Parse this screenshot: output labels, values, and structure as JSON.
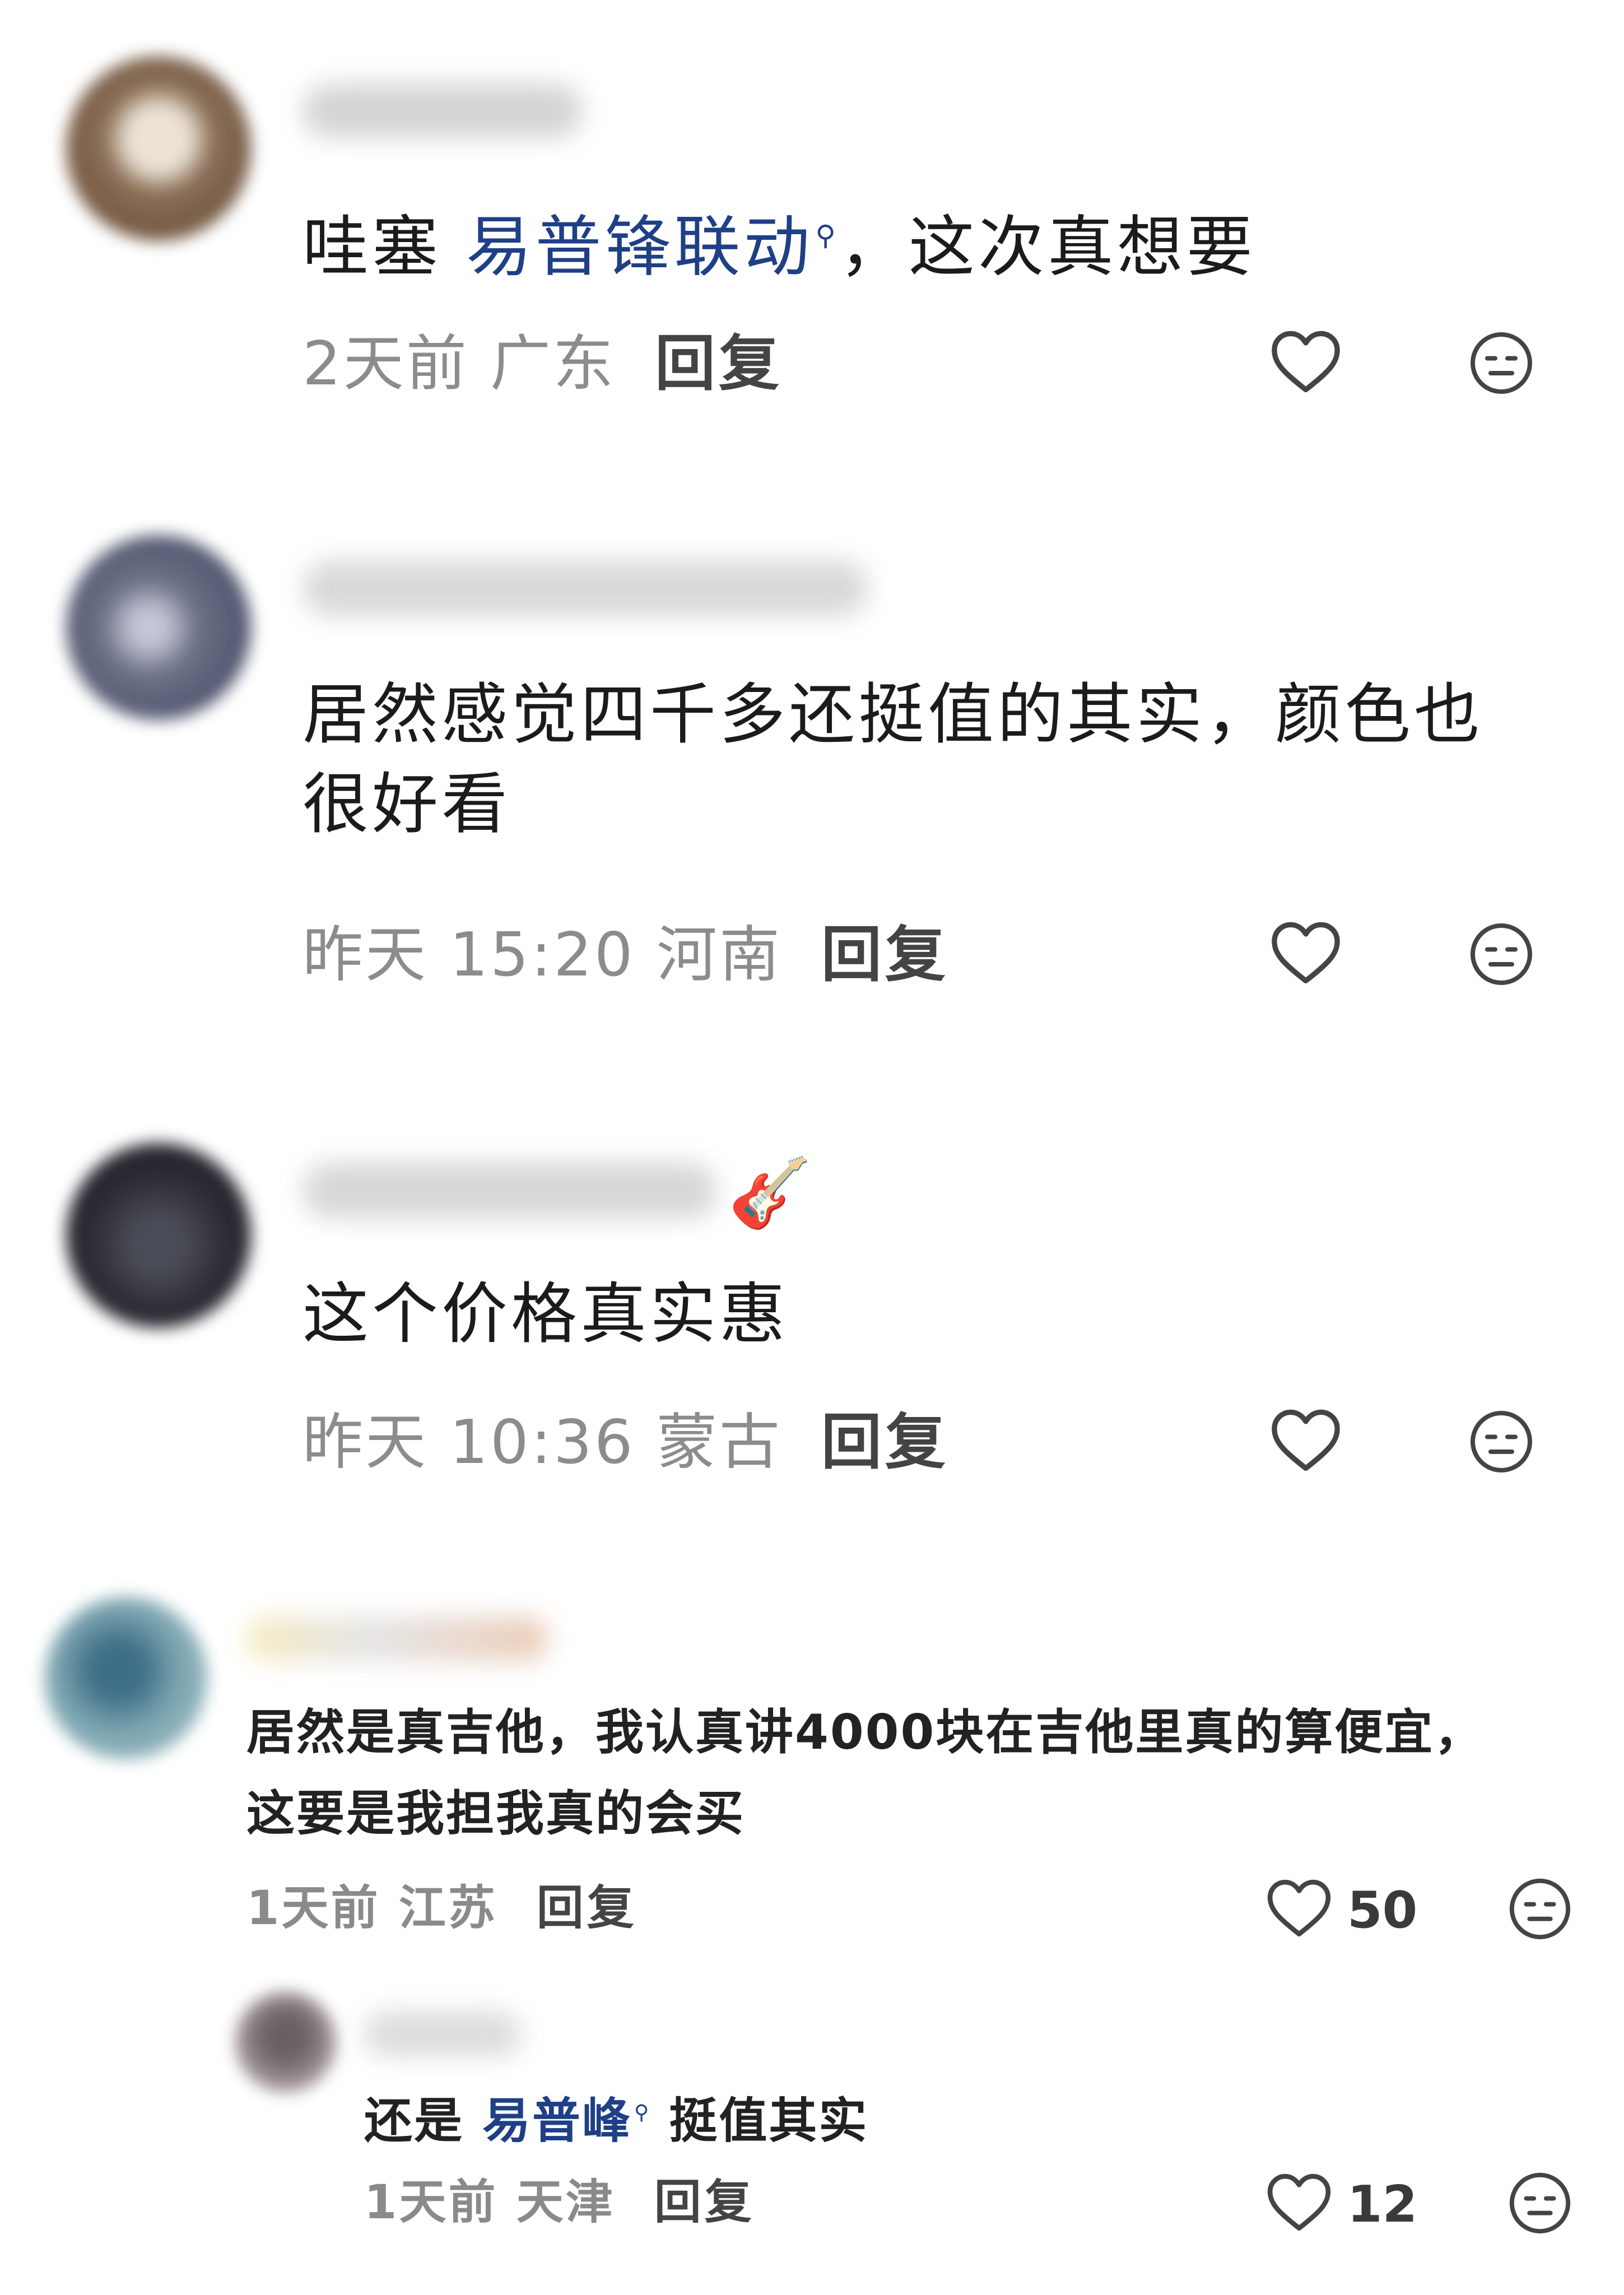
{
  "comments": [
    {
      "text_before": "哇塞 ",
      "mention": "易普锋联动",
      "text_after": "，这次真想要",
      "time_location": "2天前 广东",
      "reply_label": "回复"
    },
    {
      "text_line1": "居然感觉四千多还挺值的其实，颜色也",
      "text_line2": "很好看",
      "time_location": "昨天 15:20 河南",
      "reply_label": "回复"
    },
    {
      "text": "这个价格真实惠",
      "time_location": "昨天 10:36 蒙古",
      "reply_label": "回复",
      "name_emoji": "🎸"
    },
    {
      "text_line1": "居然是真吉他，我认真讲4000块在吉他里真的算便宜，",
      "text_line2": "这要是我担我真的会买",
      "time_location": "1天前 江苏",
      "reply_label": "回复",
      "like_count": "50",
      "reply": {
        "text_before": "还是 ",
        "mention": "易普峰",
        "text_after": " 挺值其实",
        "time_location": "1天前 天津",
        "reply_label": "回复",
        "like_count": "12"
      }
    }
  ],
  "icons": {
    "like": "heart-outline-icon",
    "dislike": "meh-face-icon"
  },
  "colors": {
    "mention": "#1f3f86",
    "meta": "#8c8c8c",
    "text": "#1b1b1b"
  }
}
